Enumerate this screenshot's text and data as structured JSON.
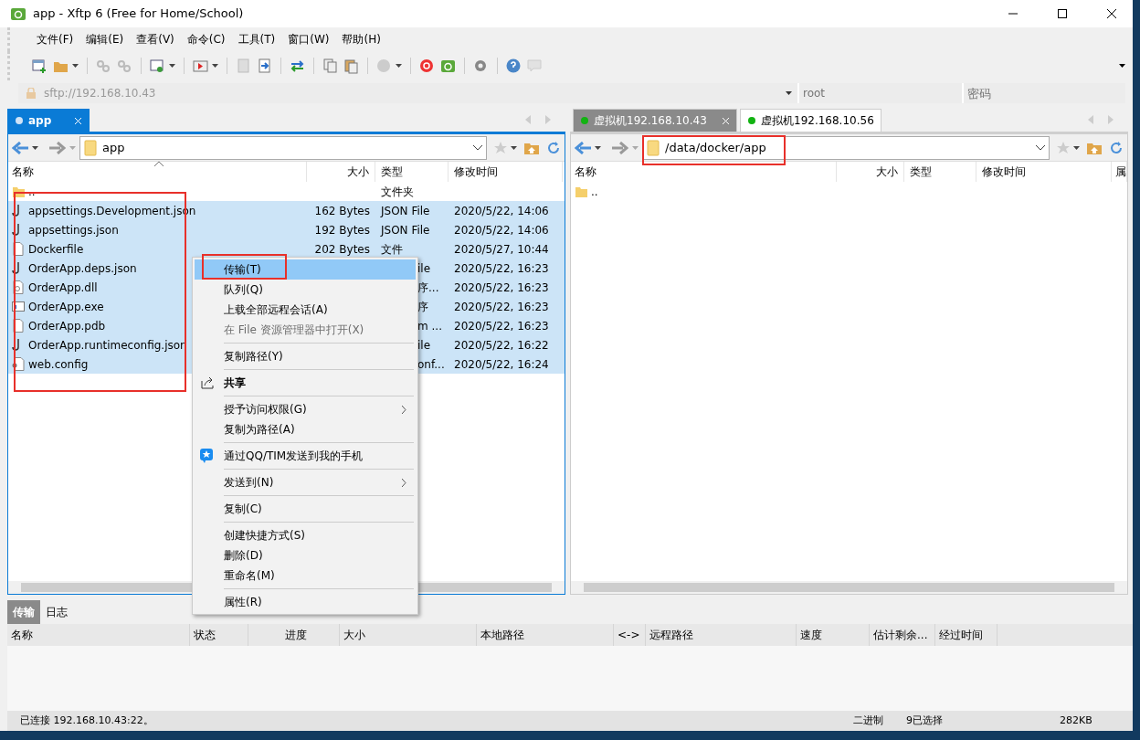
{
  "window": {
    "title": "app - Xftp 6 (Free for Home/School)"
  },
  "menu_bar": [
    "文件(F)",
    "编辑(E)",
    "查看(V)",
    "命令(C)",
    "工具(T)",
    "窗口(W)",
    "帮助(H)"
  ],
  "address_bar": {
    "url": "sftp://192.168.10.43",
    "user_placeholder": "root",
    "password_placeholder": "密码"
  },
  "left_pane": {
    "tabs": [
      {
        "label": "app",
        "selected": true
      }
    ],
    "path": "app",
    "columns": [
      "名称",
      "大小",
      "类型",
      "修改时间"
    ],
    "rows": [
      {
        "kind": "folder",
        "name": "..",
        "size": "",
        "type": "文件夹",
        "modified": "",
        "selected": false,
        "covered": false
      },
      {
        "kind": "json",
        "name": "appsettings.Development.json",
        "size": "162 Bytes",
        "type": "JSON File",
        "modified": "2020/5/22, 14:06",
        "selected": true,
        "covered": false
      },
      {
        "kind": "json",
        "name": "appsettings.json",
        "size": "192 Bytes",
        "type": "JSON File",
        "modified": "2020/5/22, 14:06",
        "selected": true,
        "covered": false
      },
      {
        "kind": "file",
        "name": "Dockerfile",
        "size": "202 Bytes",
        "type": "文件",
        "modified": "2020/5/27, 10:44",
        "selected": true,
        "covered": false
      },
      {
        "kind": "json",
        "name": "OrderApp.deps.json",
        "size": "",
        "type": "ile",
        "modified": "2020/5/22, 16:23",
        "selected": true,
        "covered": true
      },
      {
        "kind": "dll",
        "name": "OrderApp.dll",
        "size": "",
        "type": "序...",
        "modified": "2020/5/22, 16:23",
        "selected": true,
        "covered": true
      },
      {
        "kind": "exe",
        "name": "OrderApp.exe",
        "size": "",
        "type": "序",
        "modified": "2020/5/22, 16:23",
        "selected": true,
        "covered": true
      },
      {
        "kind": "file",
        "name": "OrderApp.pdb",
        "size": "",
        "type": "m ...",
        "modified": "2020/5/22, 16:23",
        "selected": true,
        "covered": true
      },
      {
        "kind": "json",
        "name": "OrderApp.runtimeconfig.json",
        "size": "",
        "type": "ile",
        "modified": "2020/5/22, 16:22",
        "selected": true,
        "covered": true
      },
      {
        "kind": "config",
        "name": "web.config",
        "size": "",
        "type": "onf...",
        "modified": "2020/5/22, 16:24",
        "selected": true,
        "covered": true
      }
    ]
  },
  "right_pane": {
    "tabs": [
      {
        "label": "虚拟机192.168.10.43",
        "selected": false,
        "color": "#12b312"
      },
      {
        "label": "虚拟机192.168.10.56",
        "selected": true,
        "color": "#12b312"
      }
    ],
    "path": "/data/docker/app",
    "columns": [
      "名称",
      "大小",
      "类型",
      "修改时间",
      "属"
    ],
    "rows": [
      {
        "kind": "folder",
        "name": ".."
      }
    ]
  },
  "context_menu": [
    {
      "kind": "item",
      "label": "传输(T)",
      "selected": true,
      "disabled": false
    },
    {
      "kind": "item",
      "label": "队列(Q)",
      "selected": false,
      "disabled": false
    },
    {
      "kind": "item",
      "label": "上载全部远程会话(A)",
      "selected": false,
      "disabled": false
    },
    {
      "kind": "item",
      "label": "在 File 资源管理器中打开(X)",
      "selected": false,
      "disabled": true
    },
    {
      "kind": "separator"
    },
    {
      "kind": "item",
      "label": "复制路径(Y)",
      "selected": false,
      "disabled": false
    },
    {
      "kind": "separator"
    },
    {
      "kind": "share",
      "label": "共享",
      "selected": false,
      "disabled": false
    },
    {
      "kind": "separator"
    },
    {
      "kind": "item",
      "label": "授予访问权限(G)",
      "selected": false,
      "disabled": false,
      "submenu": true
    },
    {
      "kind": "item",
      "label": "复制为路径(A)",
      "selected": false,
      "disabled": false
    },
    {
      "kind": "separator"
    },
    {
      "kind": "phone",
      "label": "通过QQ/TIM发送到我的手机",
      "selected": false,
      "disabled": false
    },
    {
      "kind": "separator"
    },
    {
      "kind": "item",
      "label": "发送到(N)",
      "selected": false,
      "disabled": false,
      "submenu": true
    },
    {
      "kind": "separator"
    },
    {
      "kind": "item",
      "label": "复制(C)",
      "selected": false,
      "disabled": false
    },
    {
      "kind": "separator"
    },
    {
      "kind": "item",
      "label": "创建快捷方式(S)",
      "selected": false,
      "disabled": false
    },
    {
      "kind": "item",
      "label": "删除(D)",
      "selected": false,
      "disabled": false
    },
    {
      "kind": "item",
      "label": "重命名(M)",
      "selected": false,
      "disabled": false
    },
    {
      "kind": "separator"
    },
    {
      "kind": "item",
      "label": "属性(R)",
      "selected": false,
      "disabled": false
    }
  ],
  "bottom_tabs": [
    {
      "label": "传输",
      "selected": true
    },
    {
      "label": "日志",
      "selected": false
    }
  ],
  "transfer_columns": [
    "名称",
    "状态",
    "进度",
    "大小",
    "本地路径",
    "<->",
    "远程路径",
    "速度",
    "估计剩余...",
    "经过时间"
  ],
  "status_bar": {
    "connection": "已连接 192.168.10.43:22。",
    "mode": "二进制",
    "selection": "9已选择",
    "size": "282KB"
  }
}
